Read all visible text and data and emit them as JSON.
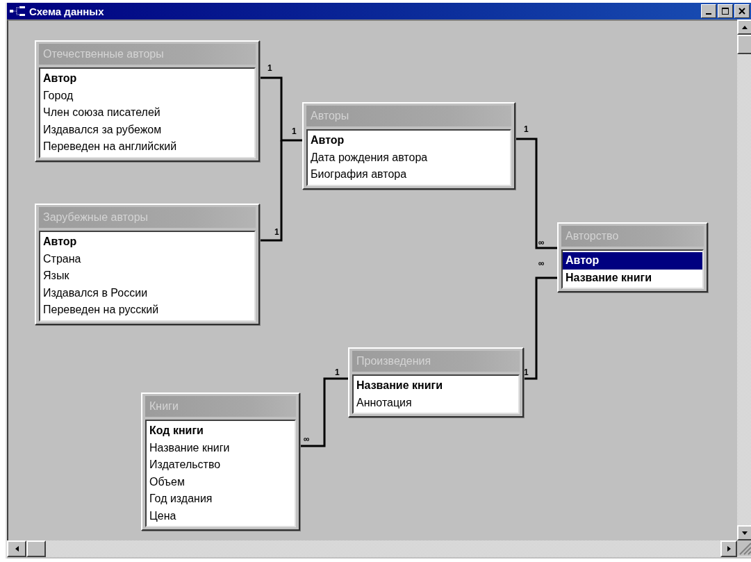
{
  "window": {
    "title": "Схема данных"
  },
  "tables": [
    {
      "title": "Отечественные авторы",
      "fields": [
        {
          "name": "Автор",
          "key": true,
          "selected": false
        },
        {
          "name": "Город",
          "key": false,
          "selected": false
        },
        {
          "name": "Член союза писателей",
          "key": false,
          "selected": false
        },
        {
          "name": "Издавался за рубежом",
          "key": false,
          "selected": false
        },
        {
          "name": "Переведен на английский",
          "key": false,
          "selected": false
        }
      ]
    },
    {
      "title": "Зарубежные авторы",
      "fields": [
        {
          "name": "Автор",
          "key": true,
          "selected": false
        },
        {
          "name": "Страна",
          "key": false,
          "selected": false
        },
        {
          "name": "Язык",
          "key": false,
          "selected": false
        },
        {
          "name": "Издавался в России",
          "key": false,
          "selected": false
        },
        {
          "name": "Переведен на русский",
          "key": false,
          "selected": false
        }
      ]
    },
    {
      "title": "Авторы",
      "fields": [
        {
          "name": "Автор",
          "key": true,
          "selected": false
        },
        {
          "name": "Дата рождения автора",
          "key": false,
          "selected": false
        },
        {
          "name": "Биография автора",
          "key": false,
          "selected": false
        }
      ]
    },
    {
      "title": "Авторство",
      "fields": [
        {
          "name": "Автор",
          "key": true,
          "selected": true
        },
        {
          "name": "Название книги",
          "key": true,
          "selected": false
        }
      ]
    },
    {
      "title": "Произведения",
      "fields": [
        {
          "name": "Название книги",
          "key": true,
          "selected": false
        },
        {
          "name": "Аннотация",
          "key": false,
          "selected": false
        }
      ]
    },
    {
      "title": "Книги",
      "fields": [
        {
          "name": "Код книги",
          "key": true,
          "selected": false
        },
        {
          "name": "Название книги",
          "key": false,
          "selected": false
        },
        {
          "name": "Издательство",
          "key": false,
          "selected": false
        },
        {
          "name": "Объем",
          "key": false,
          "selected": false
        },
        {
          "name": "Год издания",
          "key": false,
          "selected": false
        },
        {
          "name": "Цена",
          "key": false,
          "selected": false
        }
      ]
    }
  ],
  "relationships": [
    {
      "marks": [
        "1",
        "1"
      ]
    },
    {
      "marks": [
        "1"
      ]
    },
    {
      "marks": [
        "1",
        "∞"
      ]
    },
    {
      "marks": [
        "1",
        "∞"
      ]
    },
    {
      "marks": [
        "∞",
        "1"
      ]
    }
  ]
}
